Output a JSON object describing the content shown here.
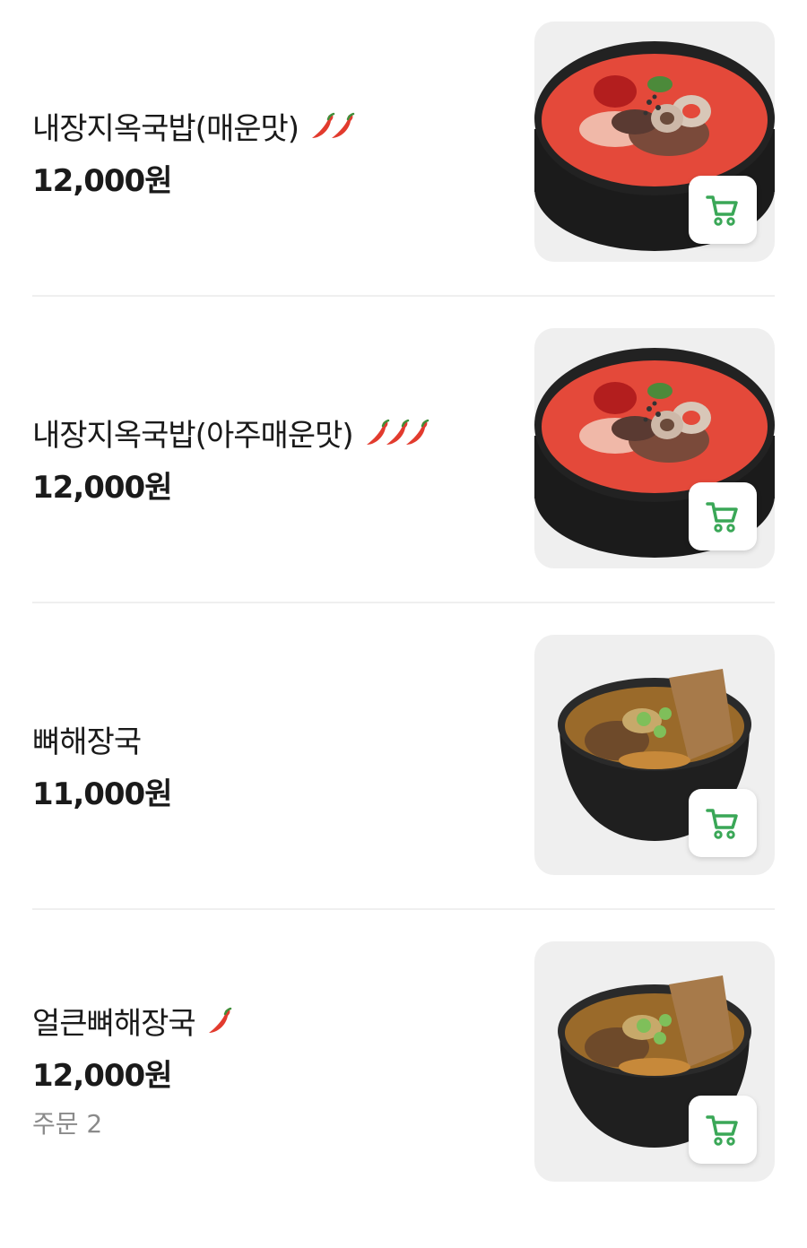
{
  "colors": {
    "cart_accent": "#3aa757",
    "chili": "#e23b2e",
    "divider": "#efefef",
    "muted_text": "#8a8a8a"
  },
  "menu_items": [
    {
      "name": "내장지옥국밥(매운맛)",
      "price": "12,000원",
      "spice_level": 2,
      "image": "spicy-soup-bowl"
    },
    {
      "name": "내장지옥국밥(아주매운맛)",
      "price": "12,000원",
      "spice_level": 3,
      "image": "spicy-soup-bowl"
    },
    {
      "name": "뼈해장국",
      "price": "11,000원",
      "spice_level": 0,
      "image": "bone-soup-bowl"
    },
    {
      "name": "얼큰뼈해장국",
      "price": "12,000원",
      "spice_level": 1,
      "order_count": "주문 2",
      "image": "bone-soup-bowl"
    }
  ],
  "icons": {
    "cart": "shopping-cart-icon",
    "spice": "chili-pepper-icon"
  }
}
